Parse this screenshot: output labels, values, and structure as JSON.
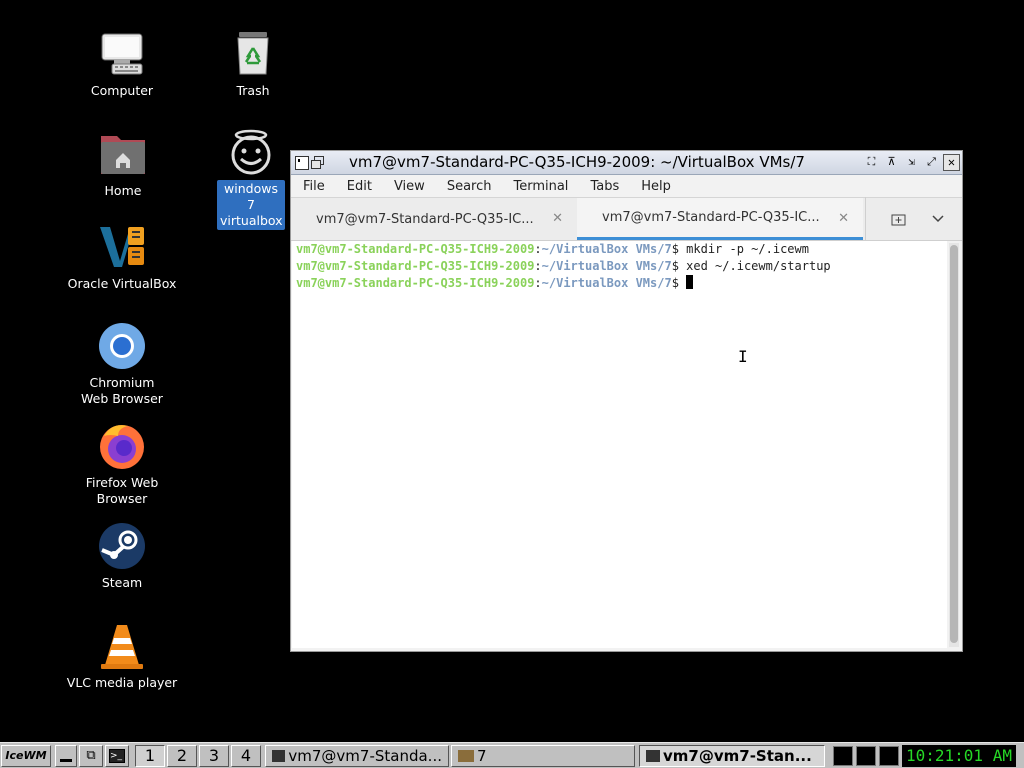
{
  "desktop": {
    "icons": [
      {
        "label": "Computer"
      },
      {
        "label": "Trash"
      },
      {
        "label": "Home"
      },
      {
        "label": "windows 7 virtualbox"
      },
      {
        "label": "Oracle VirtualBox"
      },
      {
        "label": "Chromium Web Browser"
      },
      {
        "label": "Firefox Web Browser"
      },
      {
        "label": "Steam"
      },
      {
        "label": "VLC media player"
      }
    ]
  },
  "window": {
    "title": "vm7@vm7-Standard-PC-Q35-ICH9-2009: ~/VirtualBox VMs/7",
    "menu": [
      "File",
      "Edit",
      "View",
      "Search",
      "Terminal",
      "Tabs",
      "Help"
    ],
    "tabs": [
      {
        "label": "vm7@vm7-Standard-PC-Q35-IC...",
        "active": false
      },
      {
        "label": "vm7@vm7-Standard-PC-Q35-IC...",
        "active": true
      }
    ],
    "terminal": {
      "user_host": "vm7@vm7-Standard-PC-Q35-ICH9-2009",
      "path": "~/VirtualBox VMs/7",
      "lines": [
        {
          "cmd": "mkdir -p ~/.icewm"
        },
        {
          "cmd": "xed ~/.icewm/startup"
        },
        {
          "cmd": ""
        }
      ]
    }
  },
  "taskbar": {
    "start_label": "IceWM",
    "workspaces": [
      "1",
      "2",
      "3",
      "4"
    ],
    "tasks": [
      {
        "label": "vm7@vm7-Standa...",
        "icon": "terminal-icon"
      },
      {
        "label": "7",
        "icon": "folder-icon"
      },
      {
        "label": "vm7@vm7-Stan...",
        "icon": "terminal-icon",
        "active": true
      }
    ],
    "clock": "10:21:01 AM"
  }
}
